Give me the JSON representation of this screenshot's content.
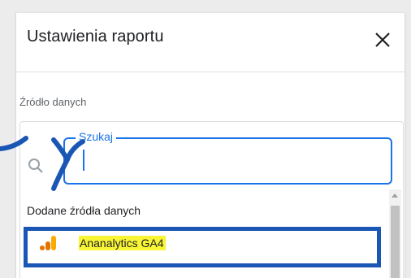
{
  "panel": {
    "title": "Ustawienia raportu"
  },
  "data_source": {
    "label": "Źródło danych"
  },
  "search": {
    "label": "Szukaj",
    "value": "",
    "placeholder": ""
  },
  "list": {
    "header": "Dodane źródła danych",
    "items": [
      {
        "name": "Ananalytics GA4",
        "icon": "google-analytics-icon",
        "highlighted": true
      }
    ]
  },
  "icons": {
    "close": "close-icon",
    "search": "search-icon"
  },
  "colors": {
    "accent": "#1a73e8",
    "annotation": "#1a56b4",
    "highlight": "#f8f535",
    "ga_orange": "#f9ab00",
    "ga_dark_orange": "#e37400"
  }
}
